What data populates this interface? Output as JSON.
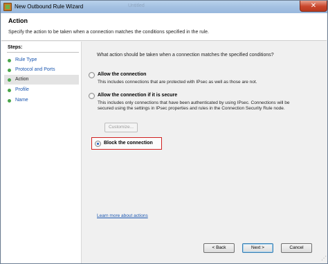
{
  "window": {
    "title": "New Outbound Rule Wizard",
    "background_title": "Untitled",
    "close_glyph": "✕"
  },
  "header": {
    "heading": "Action",
    "description": "Specify the action to be taken when a connection matches the conditions specified in the rule."
  },
  "steps": {
    "title": "Steps:",
    "items": [
      {
        "label": "Rule Type",
        "active": false
      },
      {
        "label": "Protocol and Ports",
        "active": false
      },
      {
        "label": "Action",
        "active": true
      },
      {
        "label": "Profile",
        "active": false
      },
      {
        "label": "Name",
        "active": false
      }
    ]
  },
  "main": {
    "question": "What action should be taken when a connection matches the specified conditions?",
    "options": [
      {
        "label": "Allow the connection",
        "description": "This includes connections that are protected with IPsec as well as those are not.",
        "selected": false
      },
      {
        "label": "Allow the connection if it is secure",
        "description": "This includes only connections that have been authenticated by using IPsec.  Connections will be secured using the settings in IPsec properties and rules in the Connection Security Rule node.",
        "selected": false
      },
      {
        "label": "Block the connection",
        "description": "",
        "selected": true
      }
    ],
    "customize_label": "Customize...",
    "learn_more": "Learn more about actions"
  },
  "buttons": {
    "back": "< Back",
    "next": "Next >",
    "cancel": "Cancel"
  },
  "colors": {
    "link": "#1a56b0",
    "step_dot": "#4aa64a",
    "highlight_border": "#d02020"
  }
}
